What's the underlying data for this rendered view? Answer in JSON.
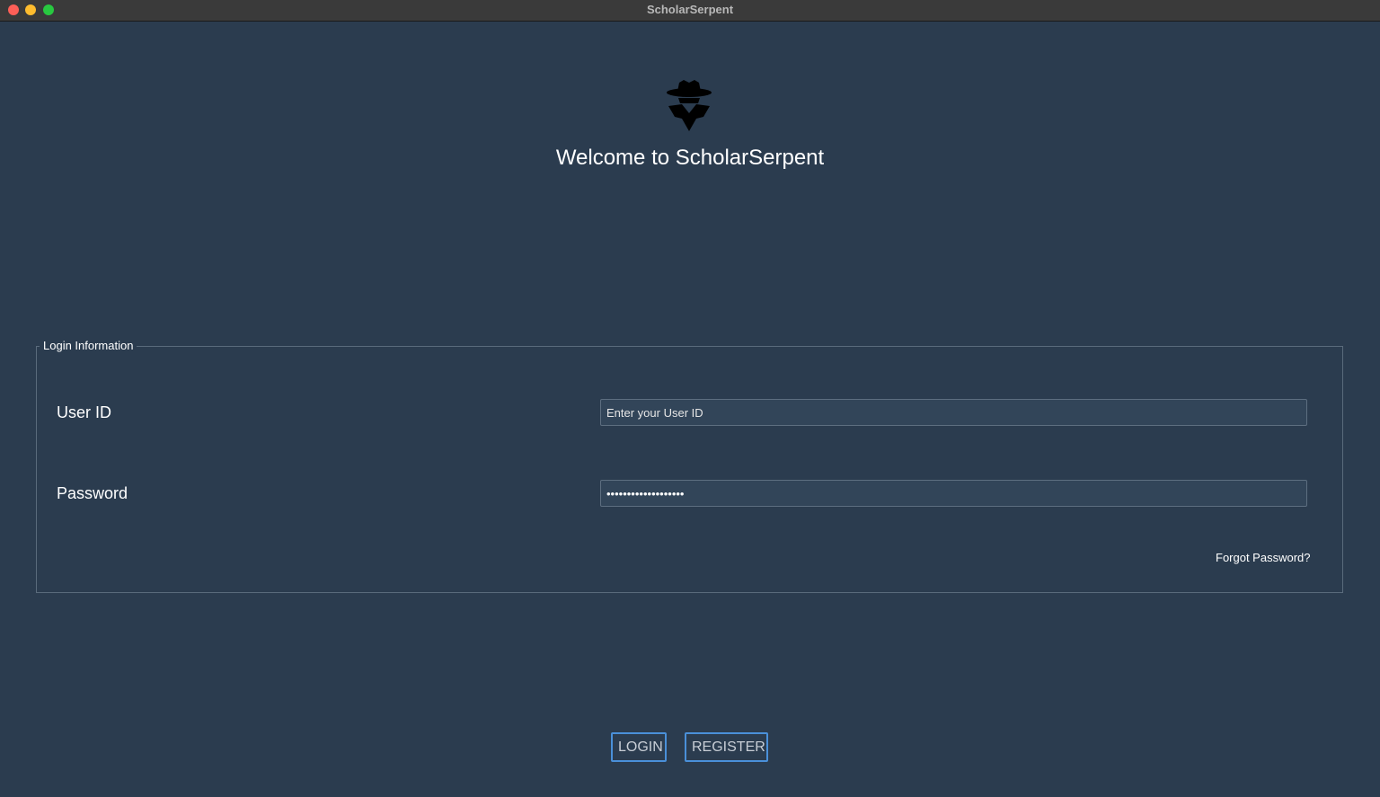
{
  "window": {
    "title": "ScholarSerpent"
  },
  "header": {
    "logo_icon": "spy-agent-icon",
    "welcome_text": "Welcome to ScholarSerpent"
  },
  "login_group": {
    "legend": "Login Information",
    "user_id_label": "User ID",
    "user_id_placeholder": "Enter your User ID",
    "user_id_value": "",
    "password_label": "Password",
    "password_value": "•••••••••••••••••••",
    "forgot_password": "Forgot Password?"
  },
  "actions": {
    "login_label": "LOGIN",
    "register_label": "REGISTER"
  },
  "colors": {
    "background": "#2b3c4f",
    "button_border": "#4a90d9",
    "text": "#ffffff"
  }
}
